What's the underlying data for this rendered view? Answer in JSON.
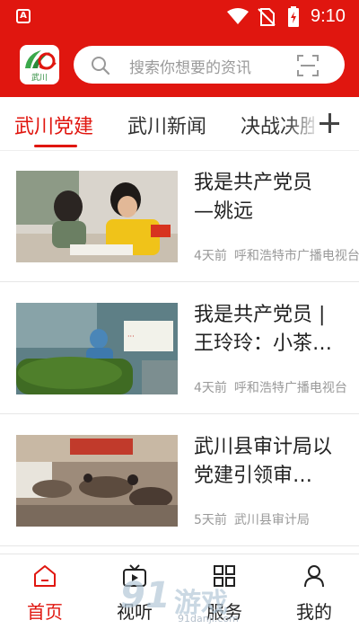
{
  "status_bar": {
    "app_icon_label": "A",
    "time": "9:10",
    "icons": [
      "wifi-icon",
      "no-sim-icon",
      "battery-charging-icon"
    ]
  },
  "header": {
    "logo_caption": "武川",
    "search_placeholder": "搜索你想要的资讯",
    "icons": [
      "search-icon",
      "scan-icon"
    ],
    "background_color": "#e0160f"
  },
  "tabs": [
    {
      "label": "武川党建",
      "active": true
    },
    {
      "label": "武川新闻",
      "active": false
    },
    {
      "label": "决战决胜",
      "active": false
    }
  ],
  "tab_add_icon": "plus-icon",
  "accent_color": "#e0160f",
  "news": [
    {
      "title": "我是共产党员\n—姚远",
      "age": "4天前",
      "source": "呼和浩特市广播电视台"
    },
    {
      "title": "我是共产党员 | 王玲玲：小茶…",
      "age": "4天前",
      "source": "呼和浩特广播电视台"
    },
    {
      "title": "武川县审计局以党建引领审…",
      "age": "5天前",
      "source": "武川县审计局"
    }
  ],
  "bottom_nav": [
    {
      "label": "首页",
      "icon": "home-icon",
      "active": true
    },
    {
      "label": "视听",
      "icon": "video-icon",
      "active": false
    },
    {
      "label": "服务",
      "icon": "grid-icon",
      "active": false
    },
    {
      "label": "我的",
      "icon": "user-icon",
      "active": false
    }
  ],
  "watermark": {
    "brand": "91",
    "text": "游戏",
    "url": "91danji.com"
  }
}
